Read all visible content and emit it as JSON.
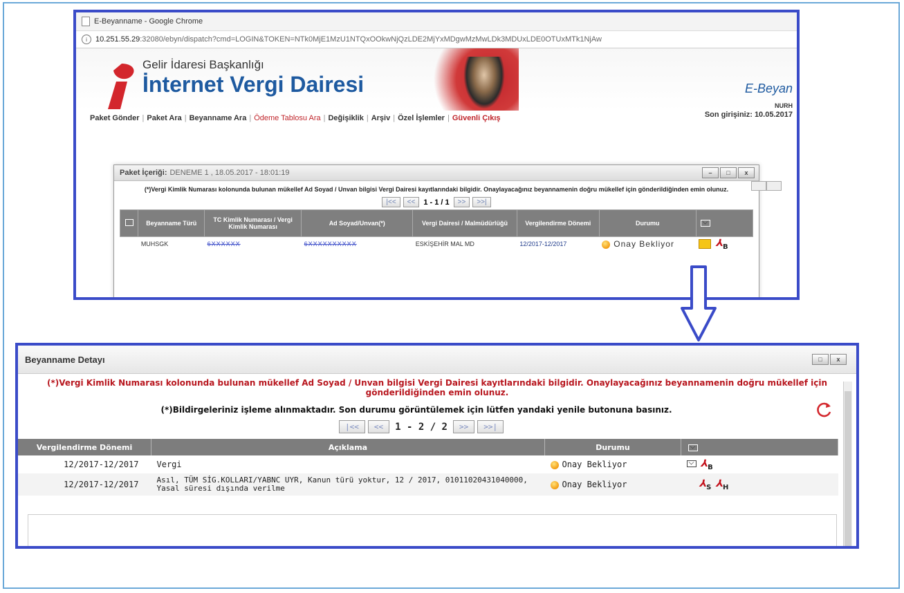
{
  "top": {
    "window_title": "E-Beyanname - Google Chrome",
    "url_host": "10.251.55.29",
    "url_rest": ":32080/ebyn/dispatch?cmd=LOGIN&TOKEN=NTk0MjE1MzU1NTQxOOkwNjQzLDE2MjYxMDgwMzMwLDk3MDUxLDE0OTUxMTk1NjAw",
    "header_sub": "Gelir İdaresi Başkanlığı",
    "header_main": "İnternet Vergi Dairesi",
    "header_right": "E-Beyan",
    "user": "NURH",
    "nav": [
      {
        "label": "Paket Gönder",
        "red": false
      },
      {
        "label": "Paket Ara",
        "red": false
      },
      {
        "label": "Beyanname Ara",
        "red": false
      },
      {
        "label": "Ödeme Tablosu Ara",
        "red": true
      },
      {
        "label": "Değişiklik",
        "red": false
      },
      {
        "label": "Arşiv",
        "red": false
      },
      {
        "label": "Özel İşlemler",
        "red": false
      },
      {
        "label": "Güvenli Çıkış",
        "red": true
      }
    ],
    "last_login": "Son girişiniz: 10.05.2017",
    "dialog": {
      "title": "Paket İçeriği:",
      "title_value": "DENEME 1 , 18.05.2017 - 18:01:19",
      "notice": "(*)Vergi Kimlik Numarası kolonunda bulunan mükellef Ad Soyad / Unvan bilgisi Vergi Dairesi kayıtlarındaki bilgidir. Onaylayacağınız beyannamenin doğru mükellef için gönderildiğinden emin olunuz.",
      "pager": {
        "first": "|<<",
        "prev": "<<",
        "text": "1 - 1 / 1",
        "next": ">>",
        "last": ">>|"
      },
      "columns": [
        "",
        "Beyanname Türü",
        "TC Kimlik Numarası / Vergi Kimlik Numarası",
        "Ad Soyad/Unvan(*)",
        "Vergi Dairesi / Malmüdürlüğü",
        "Vergilendirme Dönemi",
        "Durumu",
        ""
      ],
      "row": {
        "tur": "MUHSGK",
        "tckn": "6XXXXXX",
        "ad": "6XXXXXXXXXX",
        "vd": "ESKİŞEHİR MAL MD",
        "donem": "12/2017-12/2017",
        "durum": "Onay Bekliyor"
      }
    }
  },
  "bottom": {
    "title": "Beyanname Detayı",
    "notice_red": "(*)Vergi Kimlik Numarası kolonunda bulunan mükellef Ad Soyad / Unvan bilgisi Vergi Dairesi kayıtlarındaki bilgidir. Onaylayacağınız beyannamenin doğru mükellef için gönderildiğinden emin olunuz.",
    "notice_black": "(*)Bildirgeleriniz işleme alınmaktadır. Son durumu görüntülemek için lütfen yandaki yenile butonuna basınız.",
    "pager": {
      "first": "|<<",
      "prev": "<<",
      "text": "1 - 2 / 2",
      "next": ">>",
      "last": ">>|"
    },
    "columns": [
      "Vergilendirme Dönemi",
      "Açıklama",
      "Durumu",
      ""
    ],
    "rows": [
      {
        "donem": "12/2017-12/2017",
        "aciklama": "Vergi",
        "durum": "Onay Bekliyor"
      },
      {
        "donem": "12/2017-12/2017",
        "aciklama": "Asıl, TÜM SİG.KOLLARI/YABNC UYR, Kanun türü yoktur, 12 / 2017, 01011020431040000, Yasal süresi dışında verilme",
        "durum": "Onay Bekliyor"
      }
    ]
  },
  "icons": {
    "pdf_letter_b": "B",
    "pdf_letter_s": "S",
    "pdf_letter_h": "H",
    "status_dot_color": "#f39c12",
    "accent_blue": "#3a4bc8",
    "alert_red": "#b8171f"
  }
}
